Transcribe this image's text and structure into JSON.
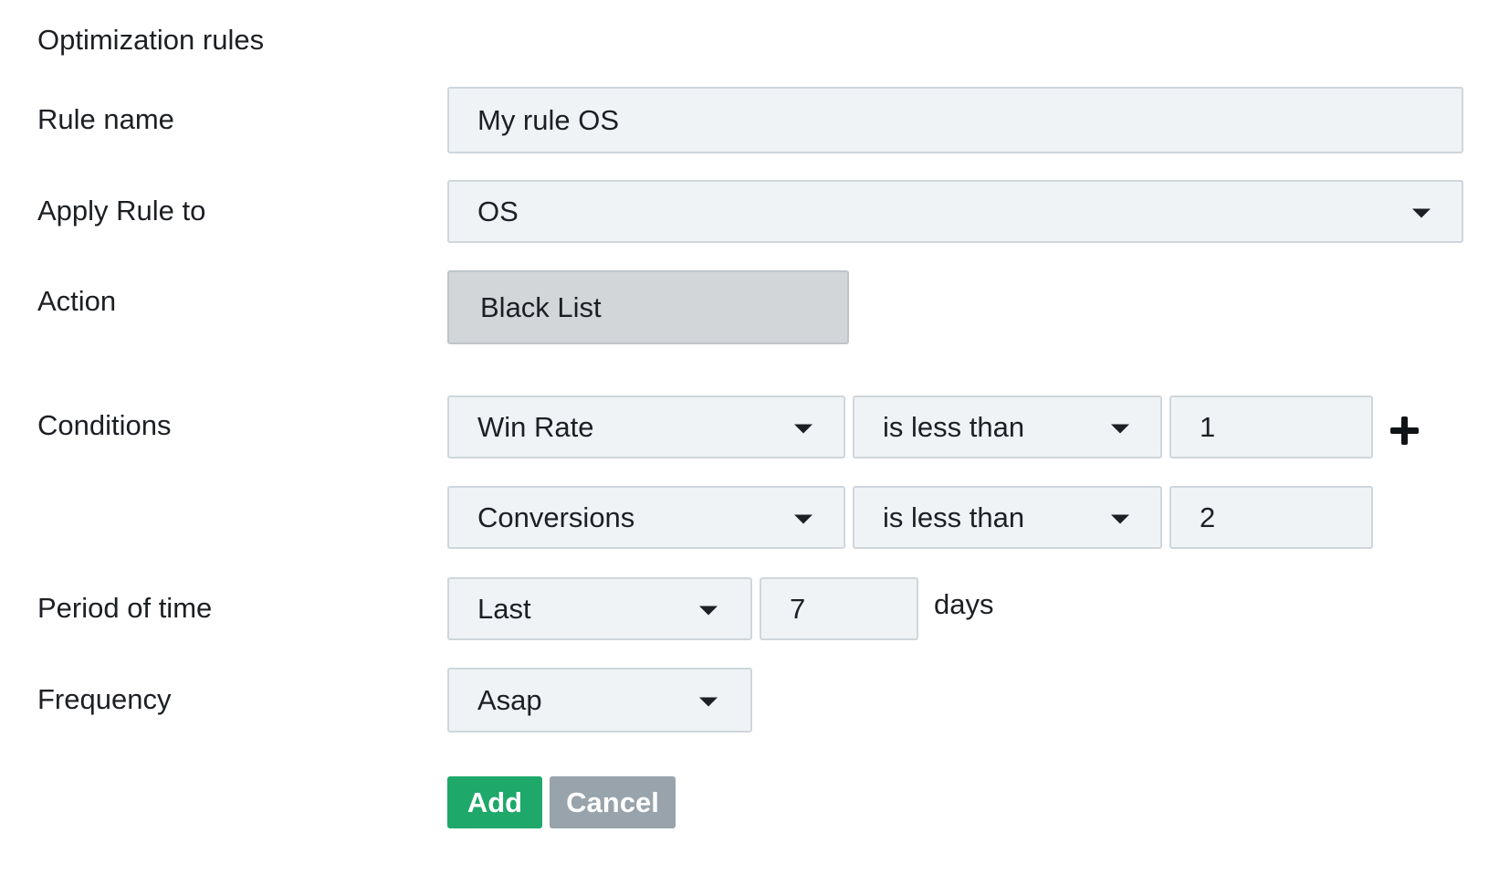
{
  "form": {
    "title": "Optimization rules",
    "rule_name": {
      "label": "Rule name",
      "value": "My rule OS"
    },
    "apply_rule_to": {
      "label": "Apply Rule to",
      "value": "OS"
    },
    "action": {
      "label": "Action",
      "value": "Black List"
    },
    "conditions": {
      "label": "Conditions",
      "rows": [
        {
          "metric": "Win Rate",
          "operator": "is less than",
          "value": "1"
        },
        {
          "metric": "Conversions",
          "operator": "is less than",
          "value": "2"
        }
      ]
    },
    "period": {
      "label": "Period of time",
      "mode": "Last",
      "value": "7",
      "unit": "days"
    },
    "frequency": {
      "label": "Frequency",
      "value": "Asap"
    },
    "buttons": {
      "add": "Add",
      "cancel": "Cancel"
    }
  },
  "icons": {
    "add_condition": "plus-icon",
    "dropdown": "caret-down-icon"
  },
  "colors": {
    "add_button": "#1ea86a",
    "cancel_button": "#98a3ab",
    "field_background": "#eff3f6",
    "action_background": "#d3d6d9"
  }
}
